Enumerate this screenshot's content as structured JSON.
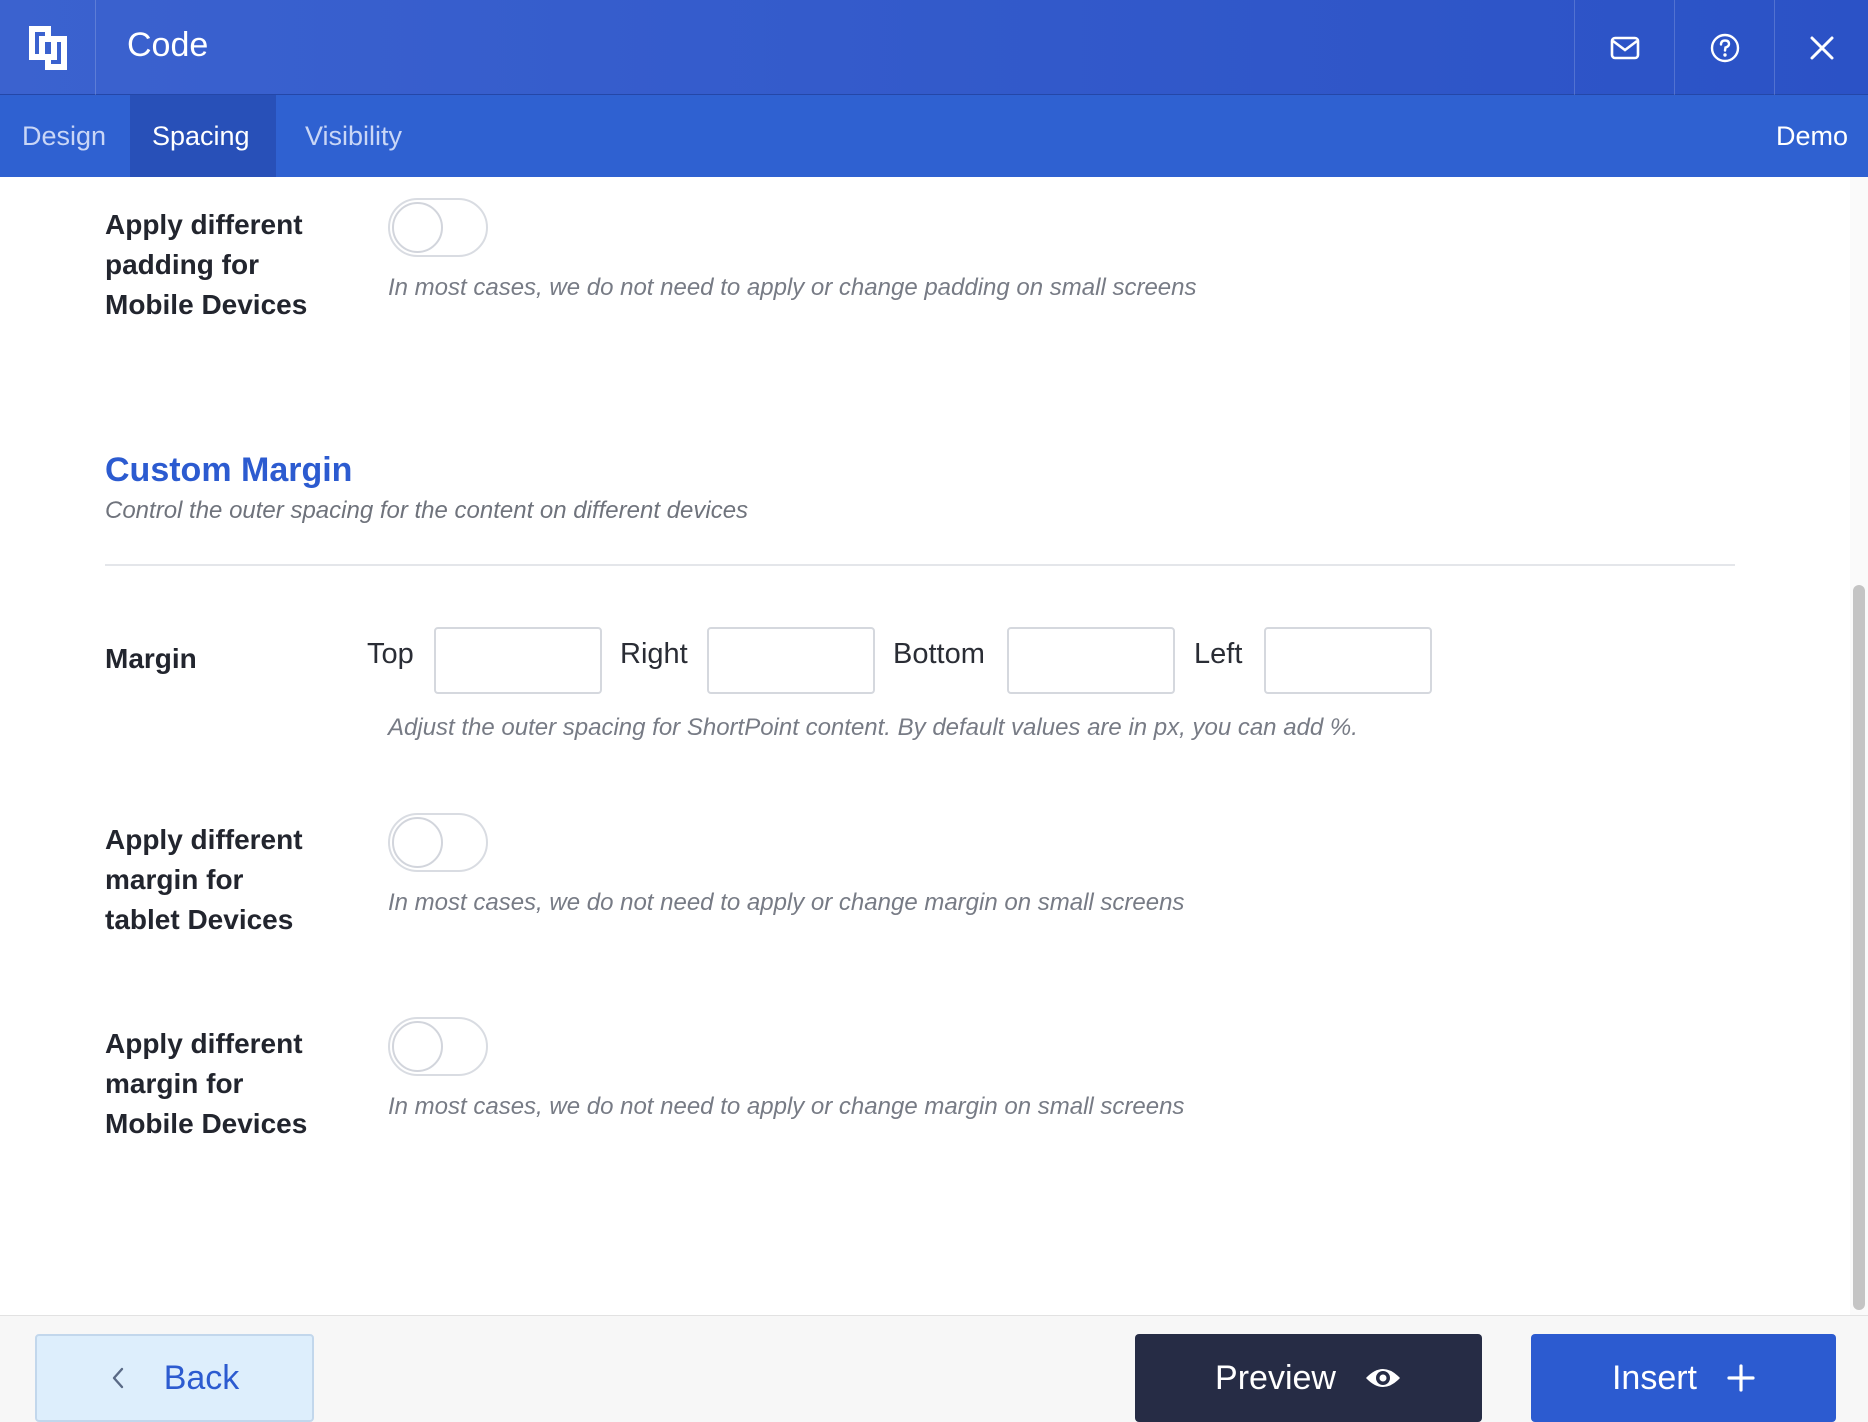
{
  "header": {
    "title": "Code",
    "logo_icon": "shortpoint-logo-icon",
    "mail_icon": "mail-icon",
    "help_icon": "help-icon",
    "close_icon": "close-icon"
  },
  "tabs": [
    {
      "label": "Design",
      "active": false
    },
    {
      "label": "Spacing",
      "active": true
    },
    {
      "label": "Visibility",
      "active": false
    }
  ],
  "demo_label": "Demo",
  "padding_mobile": {
    "label_line1": "Apply different",
    "label_line2": "padding for",
    "label_line3": "Mobile Devices",
    "hint": "In most cases, we do not need to apply or change padding on small screens",
    "enabled": false
  },
  "custom_margin": {
    "title": "Custom Margin",
    "subtitle": "Control the outer spacing for the content on different devices",
    "row_label": "Margin",
    "top_label": "Top",
    "right_label": "Right",
    "bottom_label": "Bottom",
    "left_label": "Left",
    "top_value": "",
    "right_value": "",
    "bottom_value": "",
    "left_value": "",
    "hint": "Adjust the outer spacing for ShortPoint content. By default values are in px, you can add %."
  },
  "margin_tablet": {
    "label_line1": "Apply different",
    "label_line2": "margin for",
    "label_line3": "tablet Devices",
    "hint": "In most cases, we do not need to apply or change margin on small screens",
    "enabled": false
  },
  "margin_mobile": {
    "label_line1": "Apply different",
    "label_line2": "margin for",
    "label_line3": "Mobile Devices",
    "hint": "In most cases, we do not need to apply or change margin on small screens",
    "enabled": false
  },
  "footer": {
    "back_label": "Back",
    "preview_label": "Preview",
    "insert_label": "Insert",
    "back_icon": "chevron-left-icon",
    "preview_icon": "eye-icon",
    "insert_icon": "plus-icon"
  },
  "colors": {
    "header_bg": "#2b52c6",
    "tab_bar_bg": "#2f61d1",
    "active_tab_bg": "#2850b8",
    "accent": "#2c5bd0",
    "preview_bg": "#262c45",
    "back_bg": "#ddeefc"
  }
}
